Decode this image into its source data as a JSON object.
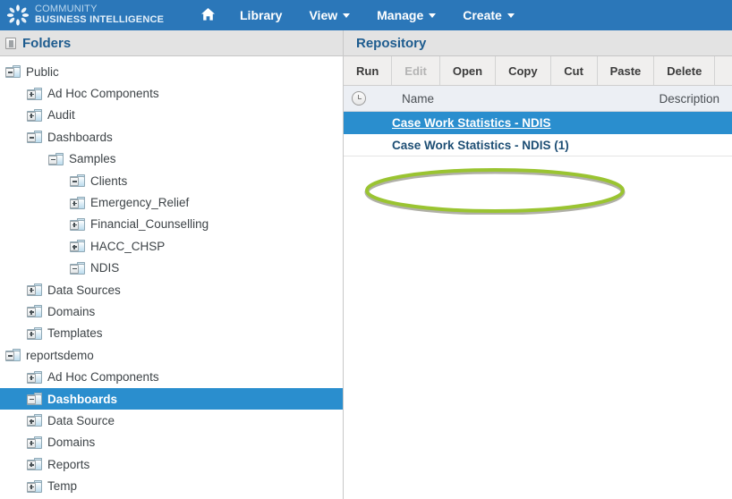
{
  "header": {
    "brand_line1": "COMMUNITY",
    "brand_line2": "BUSINESS INTELLIGENCE",
    "brand_icon": "burst-logo-icon",
    "home_icon": "home-icon",
    "nav": [
      {
        "label": "Library",
        "has_caret": false
      },
      {
        "label": "View",
        "has_caret": true
      },
      {
        "label": "Manage",
        "has_caret": true
      },
      {
        "label": "Create",
        "has_caret": true
      }
    ],
    "bar_color": "#2b77b9"
  },
  "folders_panel": {
    "title": "Folders",
    "toggle_icon": "collapse-panel-icon",
    "tree": [
      {
        "label": "Public",
        "depth": 0,
        "state": "expanded",
        "selected": false
      },
      {
        "label": "Ad Hoc Components",
        "depth": 1,
        "state": "collapsed",
        "selected": false
      },
      {
        "label": "Audit",
        "depth": 1,
        "state": "collapsed",
        "selected": false
      },
      {
        "label": "Dashboards",
        "depth": 1,
        "state": "expanded",
        "selected": false
      },
      {
        "label": "Samples",
        "depth": 2,
        "state": "expanded",
        "selected": false
      },
      {
        "label": "Clients",
        "depth": 3,
        "state": "expanded",
        "selected": false
      },
      {
        "label": "Emergency_Relief",
        "depth": 3,
        "state": "collapsed",
        "selected": false
      },
      {
        "label": "Financial_Counselling",
        "depth": 3,
        "state": "collapsed",
        "selected": false
      },
      {
        "label": "HACC_CHSP",
        "depth": 3,
        "state": "collapsed",
        "selected": false
      },
      {
        "label": "NDIS",
        "depth": 3,
        "state": "expanded",
        "selected": false
      },
      {
        "label": "Data Sources",
        "depth": 1,
        "state": "collapsed",
        "selected": false
      },
      {
        "label": "Domains",
        "depth": 1,
        "state": "collapsed",
        "selected": false
      },
      {
        "label": "Templates",
        "depth": 1,
        "state": "collapsed",
        "selected": false
      },
      {
        "label": "reportsdemo",
        "depth": 0,
        "state": "expanded",
        "selected": false
      },
      {
        "label": "Ad Hoc Components",
        "depth": 1,
        "state": "collapsed",
        "selected": false
      },
      {
        "label": "Dashboards",
        "depth": 1,
        "state": "expanded",
        "selected": true
      },
      {
        "label": "Data Source",
        "depth": 1,
        "state": "collapsed",
        "selected": false
      },
      {
        "label": "Domains",
        "depth": 1,
        "state": "collapsed",
        "selected": false
      },
      {
        "label": "Reports",
        "depth": 1,
        "state": "collapsed",
        "selected": false
      },
      {
        "label": "Temp",
        "depth": 1,
        "state": "collapsed",
        "selected": false
      }
    ]
  },
  "repository_panel": {
    "title": "Repository",
    "toolbar": [
      {
        "label": "Run",
        "disabled": false
      },
      {
        "label": "Edit",
        "disabled": true
      },
      {
        "label": "Open",
        "disabled": false
      },
      {
        "label": "Copy",
        "disabled": false
      },
      {
        "label": "Cut",
        "disabled": false
      },
      {
        "label": "Paste",
        "disabled": false
      },
      {
        "label": "Delete",
        "disabled": false
      }
    ],
    "columns": {
      "time_icon": "clock-icon",
      "name": "Name",
      "description": "Description"
    },
    "rows": [
      {
        "name": "Case Work Statistics - NDIS",
        "description": "",
        "selected": true
      },
      {
        "name": "Case Work Statistics - NDIS (1)",
        "description": "",
        "selected": false
      }
    ]
  },
  "annotation": {
    "type": "ellipse-highlight",
    "color": "#9ac431",
    "target_row": "Case Work Statistics - NDIS (1)"
  },
  "colors": {
    "header_blue": "#2b77b9",
    "selection_blue": "#2a8ece",
    "panel_gray": "#e3e3e3",
    "title_blue": "#1e5c8f",
    "annotation_green": "#9ac431"
  }
}
